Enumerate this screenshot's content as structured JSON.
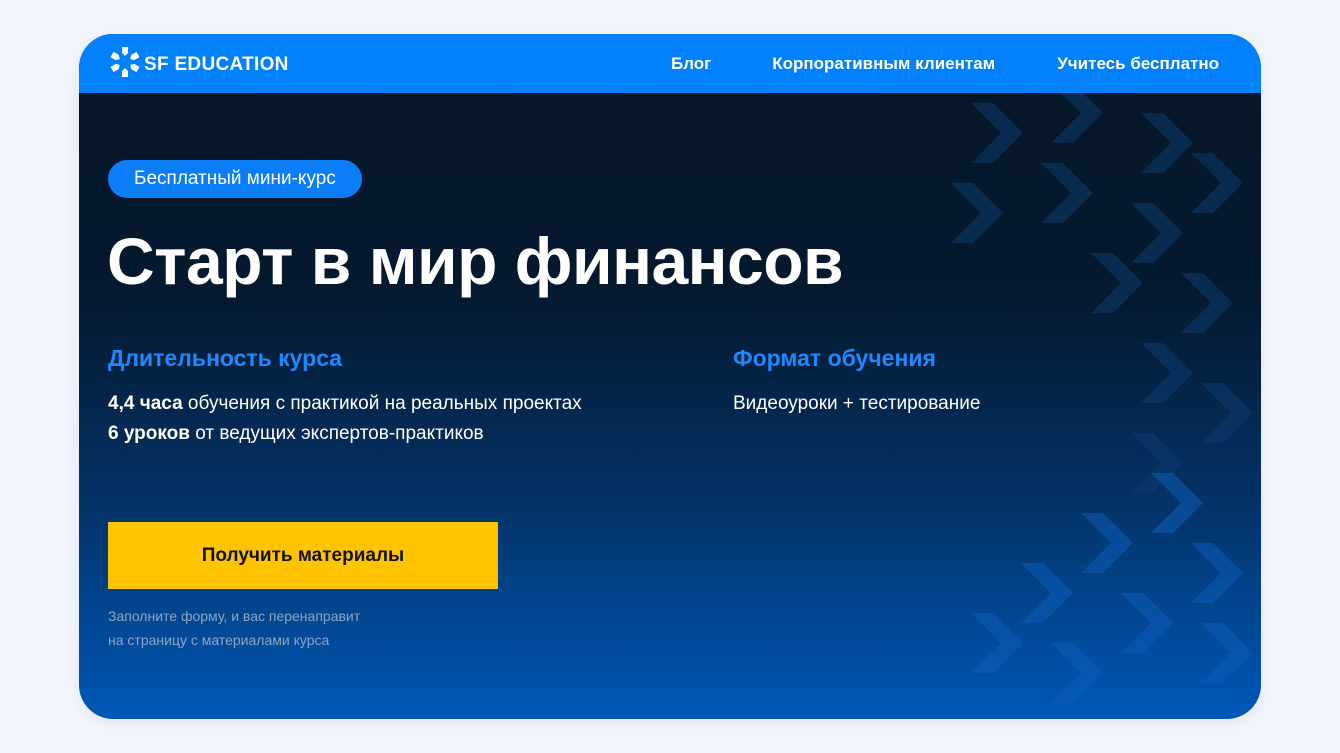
{
  "logo": {
    "text": "SF EDUCATION",
    "icon": "sf-snowflake-logo-icon"
  },
  "nav": {
    "items": [
      "Блог",
      "Корпоративным клиентам",
      "Учитесь бесплатно"
    ]
  },
  "hero": {
    "badge": "Бесплатный мини-курс",
    "title": "Старт в мир финансов",
    "duration": {
      "heading": "Длительность курса",
      "line1_bold": "4,4 часа",
      "line1_rest": " обучения с практикой на реальных проектах",
      "line2_bold": "6 уроков",
      "line2_rest": " от ведущих экспертов-практиков"
    },
    "format": {
      "heading": "Формат обучения",
      "text": "Видеоуроки + тестирование"
    },
    "cta_label": "Получить материалы",
    "note_line1": "Заполните форму, и вас перенаправит",
    "note_line2": "на страницу с материалами курса"
  },
  "colors": {
    "header": "#0281ff",
    "accent": "#1e88ff",
    "cta": "#ffc400",
    "background_dark": "#061626",
    "background_blue": "#0058b8"
  }
}
